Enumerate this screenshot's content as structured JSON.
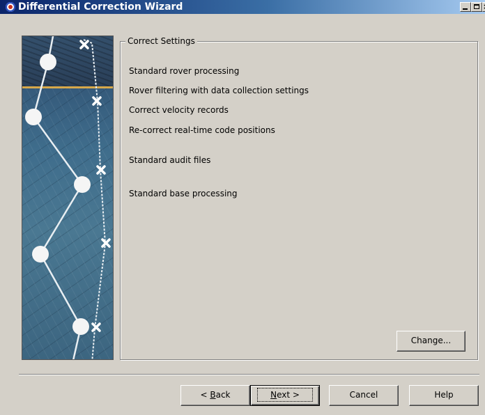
{
  "window": {
    "title": "Differential Correction Wizard",
    "title_bar_buttons": [
      "minimize",
      "maximize",
      "close"
    ]
  },
  "group": {
    "legend": "Correct Settings",
    "settings": [
      "Standard rover processing",
      "Rover filtering with data collection settings",
      "Correct velocity records",
      "Re-correct real-time code positions",
      "Standard audit files",
      "Standard base processing"
    ],
    "change_label": "Change..."
  },
  "buttons": {
    "back_label": "< Back",
    "back_prefix": "< ",
    "back_mnemonic": "B",
    "back_rest": "ack",
    "next_mnemonic": "N",
    "next_rest": "ext >",
    "cancel_label": "Cancel",
    "help_label": "Help"
  },
  "colors": {
    "dialog_face": "#d4d0c8",
    "title_start": "#0a246a",
    "title_end": "#a6caf0",
    "graphic_accent": "#d7a84a"
  },
  "icons": {
    "title": "wizard-app-icon",
    "graphic_markers": [
      "circle-marker",
      "x-marker"
    ]
  }
}
